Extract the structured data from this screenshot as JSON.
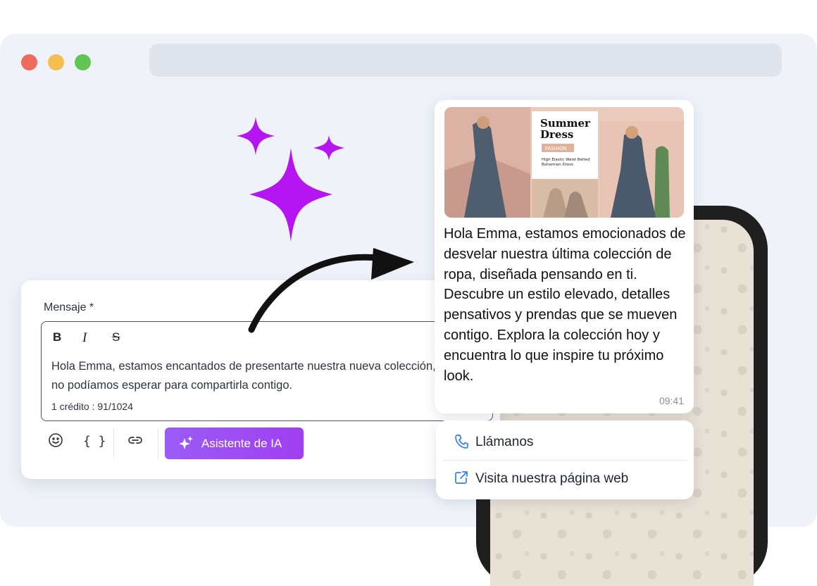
{
  "window": {
    "traffic_lights": [
      "#ed6a5e",
      "#f5bf4f",
      "#61c554"
    ]
  },
  "editor": {
    "label": "Mensaje *",
    "format_buttons": {
      "bold": "B",
      "italic": "I",
      "strike": "S"
    },
    "text_line1": "Hola Emma, estamos encantados de presentarte nuestra nueva colección,",
    "text_line2": "no podíamos esperar para compartirla contigo.",
    "credits": "1 crédito : 91/1024",
    "toolbar": {
      "emoji_icon": "smiley-icon",
      "variables_label": "{ }",
      "link_icon": "link-icon",
      "ai_button": "Asistente de IA"
    }
  },
  "bubble": {
    "media": {
      "title_line1": "Summer",
      "title_line2": "Dress",
      "tag": "FASHION",
      "subtitle_line1": "High Elastic Waist Belted",
      "subtitle_line2": "Bohemian Dress"
    },
    "text": "Hola Emma, estamos emocionados de desvelar nuestra última colección de ropa, diseñada pensando en ti. Descubre un estilo elevado, detalles pensativos y prendas que se mueven contigo. Explora la colección hoy y encuentra lo que inspire tu próximo look.",
    "time": "09:41"
  },
  "actions": {
    "call": {
      "label": "Llámanos",
      "icon": "phone-icon"
    },
    "web": {
      "label": "Visita nuestra página web",
      "icon": "external-link-icon"
    }
  },
  "colors": {
    "accent_purple": "#a03ef0",
    "sparkle": "#b515f0",
    "link_blue": "#2f80ed"
  }
}
